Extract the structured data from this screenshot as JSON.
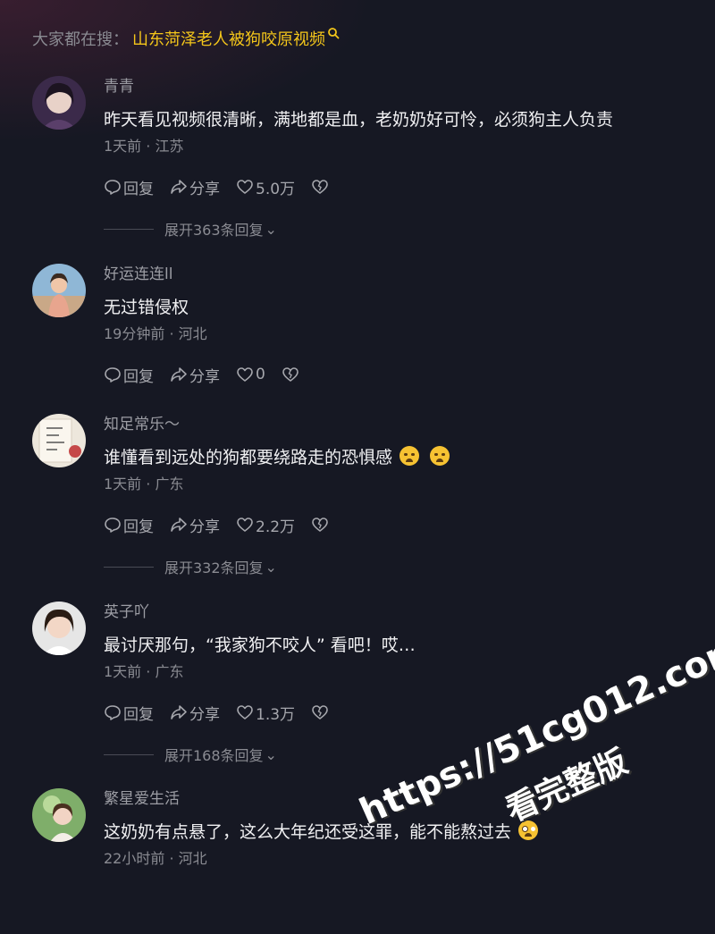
{
  "search": {
    "prefix": "大家都在搜：",
    "term": "山东菏泽老人被狗咬原视频",
    "icon": "search-icon"
  },
  "actions_labels": {
    "reply": "回复",
    "share": "分享"
  },
  "comments": [
    {
      "username": "青青",
      "text": "昨天看见视频很清晰，满地都是血，老奶奶好可怜，必须狗主人负责",
      "time": "1天前",
      "location": "江苏",
      "likes": "5.0万",
      "expand": "展开363条回复"
    },
    {
      "username": "好运连连ll",
      "text": "无过错侵权",
      "time": "19分钟前",
      "location": "河北",
      "likes": "0"
    },
    {
      "username": "知足常乐～",
      "text": "谁懂看到远处的狗都要绕路走的恐惧感",
      "time": "1天前",
      "location": "广东",
      "likes": "2.2万",
      "expand": "展开332条回复"
    },
    {
      "username": "英子吖",
      "text": "最讨厌那句，“我家狗不咬人” 看吧！哎…",
      "time": "1天前",
      "location": "广东",
      "likes": "1.3万",
      "expand": "展开168条回复"
    },
    {
      "username": "繁星爱生活",
      "text": "这奶奶有点悬了，这么大年纪还受这罪，能不能熬过去",
      "time": "22小时前",
      "location": "河北"
    }
  ],
  "meta_separator": " · ",
  "watermark": {
    "url": "https://51cg012.com",
    "caption": "看完整版"
  },
  "colors": {
    "background": "#161823",
    "search_term": "#f4c61a",
    "muted_text": "#8a8b92"
  }
}
